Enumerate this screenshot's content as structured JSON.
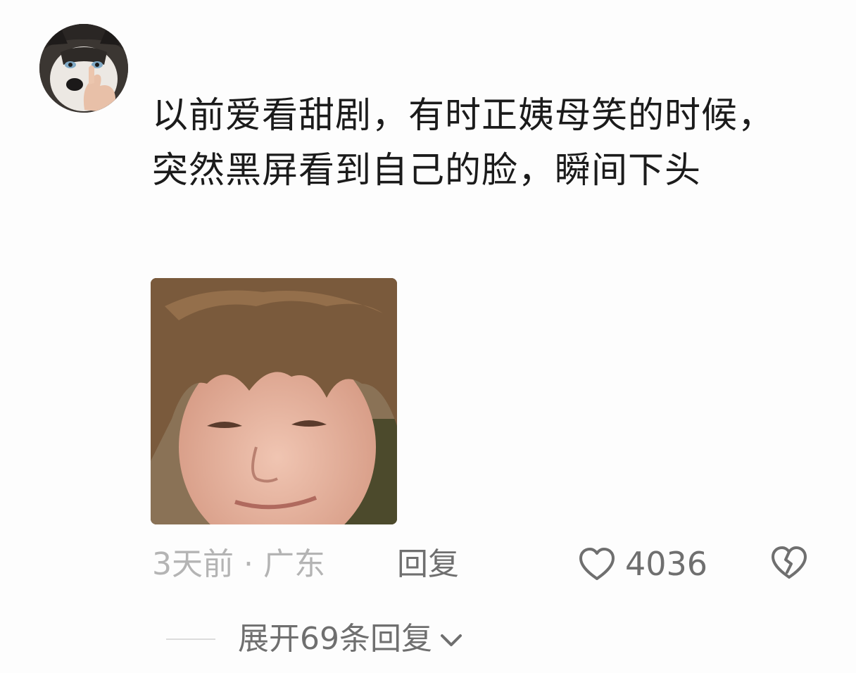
{
  "comment": {
    "avatar_icon": "husky-avatar",
    "text": "以前爱看甜剧，有时正姨母笑的时候，突然黑屏看到自己的脸，瞬间下头",
    "image_icon": "boy-face-meme"
  },
  "meta": {
    "time_location": "3天前 · 广东",
    "reply_label": "回复",
    "like_icon": "heart-outline-icon",
    "like_count": "4036",
    "dislike_icon": "broken-heart-icon"
  },
  "replies": {
    "expand_label": "展开69条回复",
    "expand_icon": "chevron-down-icon"
  },
  "colors": {
    "background": "#fdfdfd",
    "text_primary": "#1b1b1b",
    "text_secondary": "#6f6f6f",
    "text_muted": "#b4b4b4",
    "divider": "#dcdcdc"
  }
}
